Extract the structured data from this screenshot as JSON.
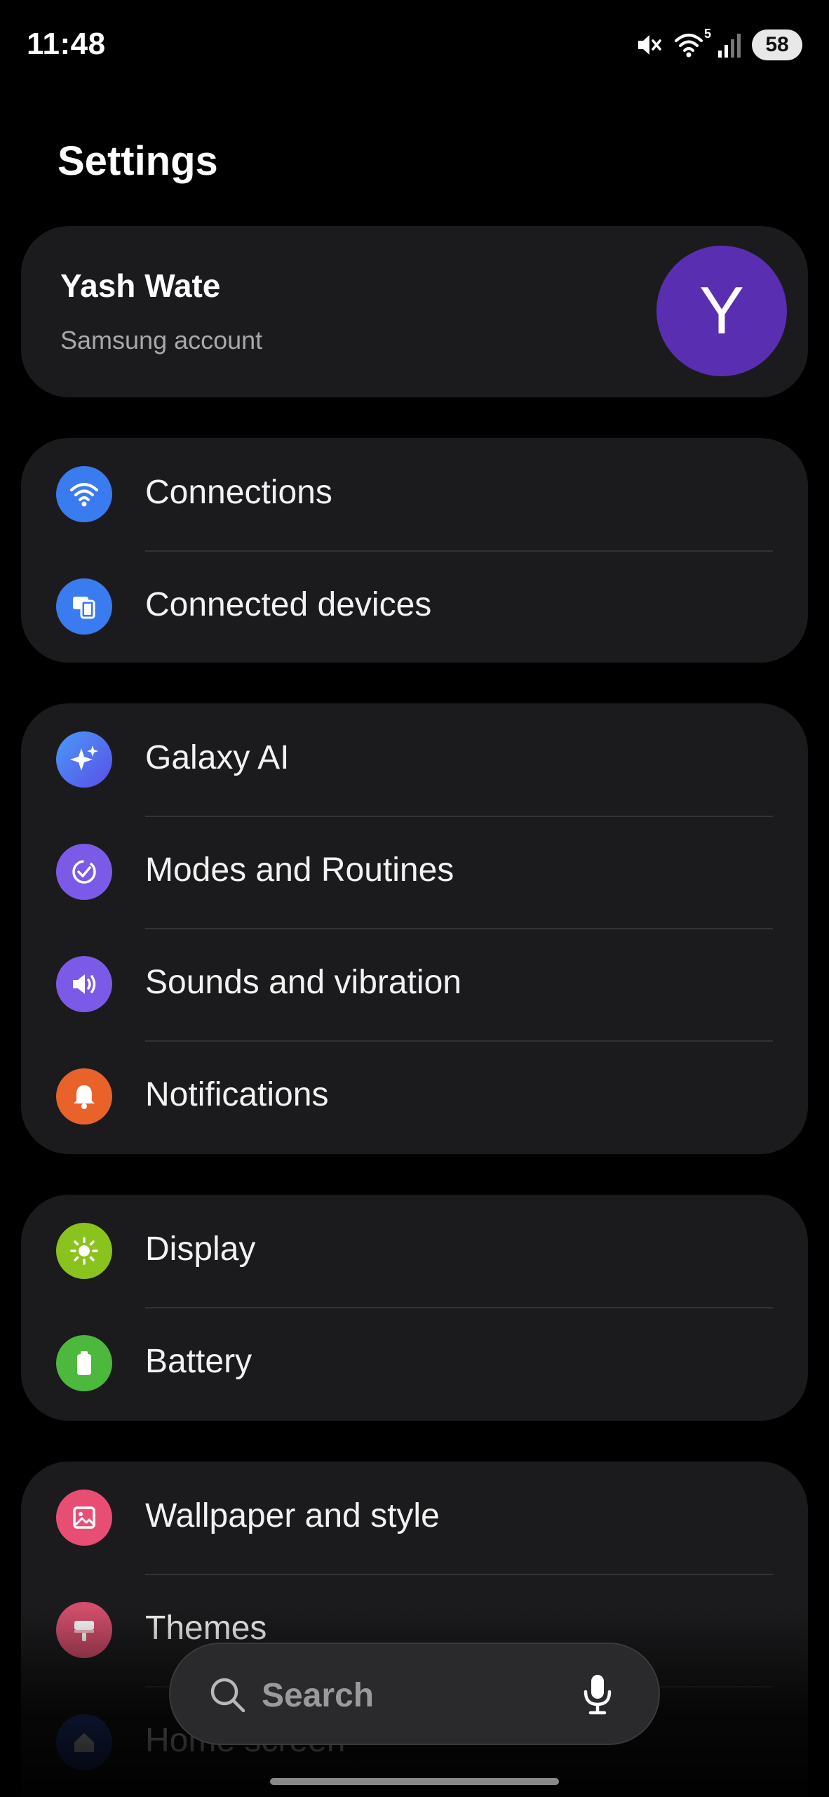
{
  "status_bar": {
    "time": "11:48",
    "battery": "58",
    "wifi_badge": "5"
  },
  "page": {
    "title": "Settings"
  },
  "account": {
    "name": "Yash Wate",
    "subtitle": "Samsung account",
    "avatar_letter": "Y",
    "avatar_color": "#5a2eb0"
  },
  "groups": [
    {
      "items": [
        {
          "label": "Connections",
          "icon": "wifi-icon",
          "color": "#3a7bf0"
        },
        {
          "label": "Connected devices",
          "icon": "connected-devices-icon",
          "color": "#3a7bf0"
        }
      ]
    },
    {
      "items": [
        {
          "label": "Galaxy AI",
          "icon": "sparkle-icon",
          "color": "#4a6cf0"
        },
        {
          "label": "Modes and Routines",
          "icon": "check-circle-icon",
          "color": "#7b5ae8"
        },
        {
          "label": "Sounds and vibration",
          "icon": "speaker-icon",
          "color": "#7b5ae8"
        },
        {
          "label": "Notifications",
          "icon": "bell-icon",
          "color": "#e8622a"
        }
      ]
    },
    {
      "items": [
        {
          "label": "Display",
          "icon": "brightness-icon",
          "color": "#8ac21e"
        },
        {
          "label": "Battery",
          "icon": "battery-icon",
          "color": "#4cb83c"
        }
      ]
    },
    {
      "items": [
        {
          "label": "Wallpaper and style",
          "icon": "wallpaper-icon",
          "color": "#e84e74"
        },
        {
          "label": "Themes",
          "icon": "paintbrush-icon",
          "color": "#d24e6c"
        },
        {
          "label": "Home screen",
          "icon": "home-icon",
          "color": "#2f4aa8"
        }
      ]
    }
  ],
  "search": {
    "placeholder": "Search"
  },
  "colors": {
    "background": "#000000",
    "card": "#1b1b1d",
    "divider": "#333336"
  }
}
